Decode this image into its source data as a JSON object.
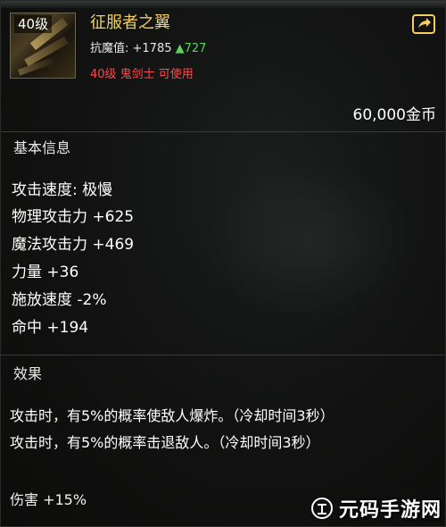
{
  "item": {
    "level_badge": "40级",
    "name": "征服者之翼",
    "resist_label": "抗魔值: +1785",
    "resist_delta": "▲727",
    "requirement": "40级 鬼剑士 可使用",
    "price": "60,000金币"
  },
  "sections": {
    "basic_title": "基本信息",
    "effect_title": "效果"
  },
  "stats": [
    "攻击速度: 极慢",
    "物理攻击力 +625",
    "魔法攻击力 +469",
    "力量 +36",
    "施放速度 -2%",
    "命中 +194"
  ],
  "effects": [
    "攻击时，有5%的概率使敌人爆炸。（冷却时间3秒）",
    "攻击时，有5%的概率击退敌人。（冷却时间3秒）"
  ],
  "damage": "伤害 +15%",
  "watermark": {
    "text": "元码手游网"
  },
  "colors": {
    "name": "#f2cf63",
    "requirement": "#ff4a4a",
    "increase": "#57d65a",
    "background": "#121312"
  },
  "icons": {
    "share": "share-icon"
  }
}
